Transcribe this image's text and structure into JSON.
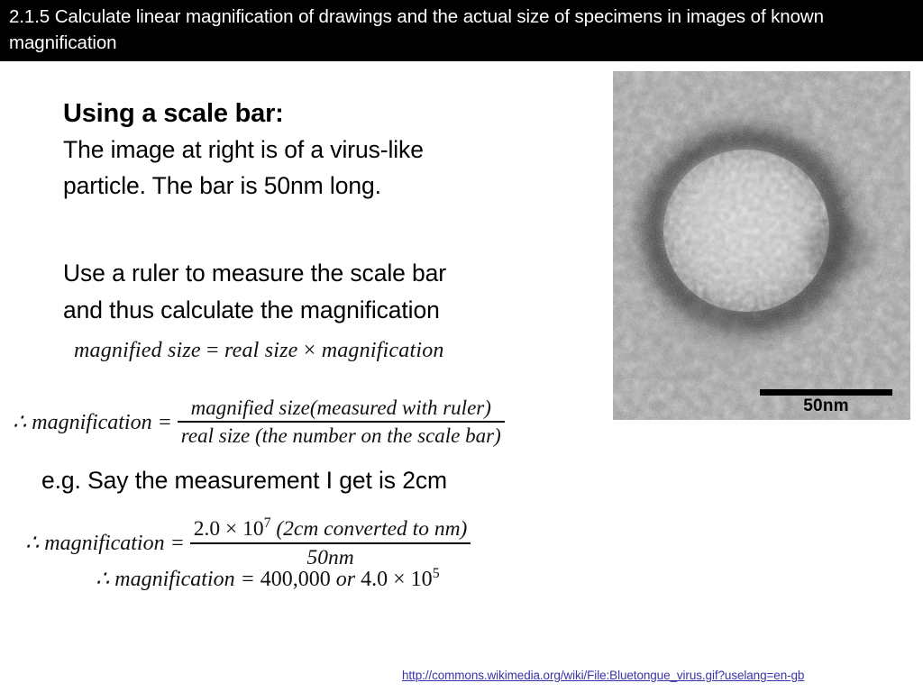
{
  "header": {
    "title": "2.1.5 Calculate linear magnification of drawings and the actual size of specimens in images of known magnification"
  },
  "content": {
    "heading": "Using a scale bar:",
    "paragraph_1_line_1": "The image at right is of a virus-like",
    "paragraph_1_line_2": "particle. The bar is 50nm long.",
    "paragraph_2_line_1": "Use a ruler to measure the scale bar",
    "paragraph_2_line_2": "and thus calculate the magnification",
    "example_line": "e.g. Say the measurement I get is 2cm"
  },
  "equations": {
    "eq1_lhs": "magnified size",
    "eq1_eq": "=",
    "eq1_rhs_a": "real size",
    "eq1_times": "×",
    "eq1_rhs_b": "magnification",
    "eq2_lhs": "∴ magnification =",
    "eq2_numerator": "magnified size(measured with ruler)",
    "eq2_denominator": "real size (the number on the scale bar)",
    "eq3_lhs": "∴ magnification =",
    "eq3_num_value": "2.0 × 10",
    "eq3_num_exponent": "7",
    "eq3_num_note": "(2cm converted to nm)",
    "eq3_denominator": "50nm",
    "eq4_lhs": "∴ magnification = ",
    "eq4_value": "400,000",
    "eq4_or": " or ",
    "eq4_alt_value": "4.0 × 10",
    "eq4_alt_exponent": "5"
  },
  "figure": {
    "scale_bar_label": "50nm",
    "alt": "transmission electron micrograph of a virus-like particle"
  },
  "footer": {
    "source_url": "http://commons.wikimedia.org/wiki/File:Bluetongue_virus.gif?uselang=en-gb"
  },
  "colors": {
    "header_background": "#000000",
    "header_text": "#ffffff",
    "page_background": "#ffffff",
    "body_text": "#000000",
    "link": "#3a34a8",
    "scale_bar": "#000000"
  }
}
